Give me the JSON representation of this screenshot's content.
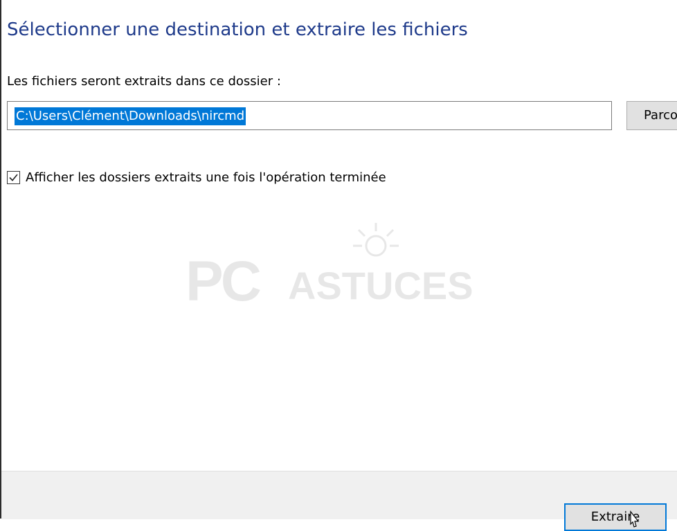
{
  "dialog": {
    "title": "Sélectionner une destination et extraire les fichiers",
    "folder_label": "Les fichiers seront extraits dans ce dossier :",
    "path_value": "C:\\Users\\Clément\\Downloads\\nircmd",
    "browse_label": "Parcourir...",
    "show_files_label": "Afficher les dossiers extraits une fois l'opération terminée",
    "show_files_checked": true
  },
  "footer": {
    "extract_label": "Extraire"
  },
  "watermark": {
    "brand_pc": "PC",
    "brand_astuces": "ASTUCES"
  },
  "colors": {
    "accent": "#0078d7",
    "title": "#1e3a8a"
  }
}
